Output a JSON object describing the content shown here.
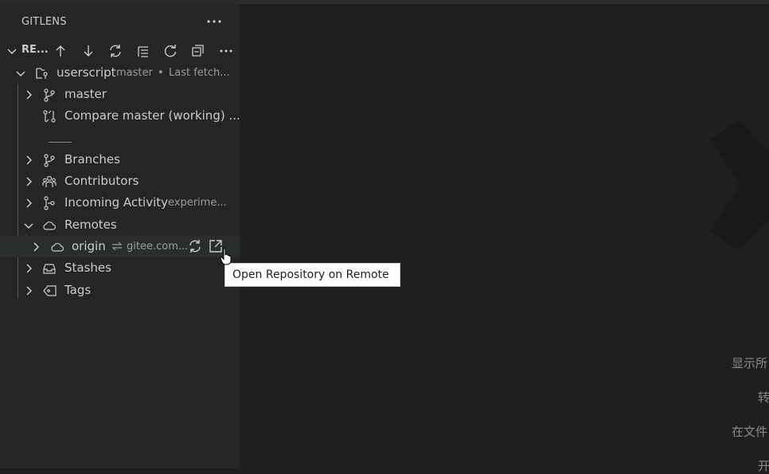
{
  "sidebar": {
    "title": "GITLENS",
    "section_title": "RE...",
    "toolbar_icons": [
      "arrow-up-icon",
      "arrow-down-icon",
      "sync-icon",
      "list-icon",
      "refresh-icon",
      "collapse-all-icon",
      "more-icon"
    ],
    "repo": {
      "name": "userscript",
      "branch": "master",
      "dot": "•",
      "status": "Last fetch..."
    },
    "items": {
      "master": "master",
      "compare": "Compare master (working) ...",
      "branches": "Branches",
      "contributors": "Contributors",
      "incoming": "Incoming Activity",
      "incoming_desc": "experime...",
      "remotes": "Remotes",
      "origin": "origin",
      "origin_desc": "gitee.com...",
      "stashes": "Stashes",
      "tags": "Tags"
    }
  },
  "tooltip": {
    "text": "Open Repository on Remote"
  },
  "editor": {
    "hints": [
      "显示所",
      "转",
      "在文件",
      "开"
    ]
  },
  "colors": {
    "sidebar_bg": "#252526",
    "editor_bg": "#1f1f1f",
    "hover_bg": "#2a2d2e"
  }
}
